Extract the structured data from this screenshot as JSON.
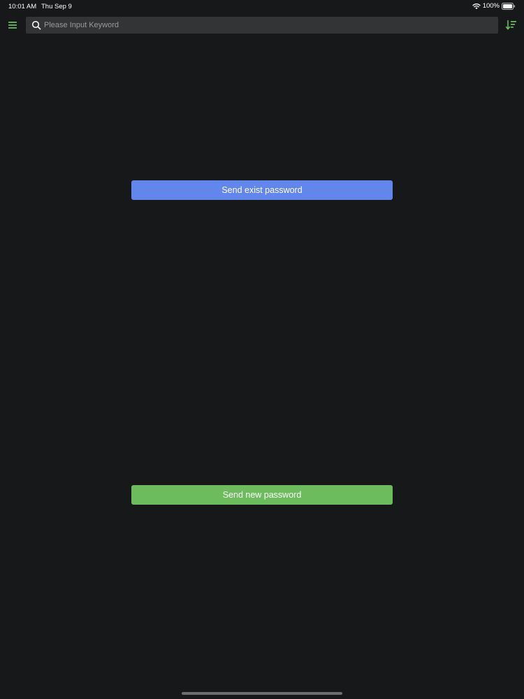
{
  "status_bar": {
    "time": "10:01 AM",
    "date": "Thu Sep 9",
    "battery": "100%"
  },
  "toolbar": {
    "menu_icon": "hamburger-menu-icon",
    "search": {
      "placeholder": "Please Input Keyword",
      "value": "",
      "icon": "search-icon"
    },
    "sort_icon": "sort-descending-icon"
  },
  "actions": {
    "send_exist_label": "Send exist password",
    "send_new_label": "Send new password"
  },
  "colors": {
    "background": "#17181a",
    "accent_green": "#6cbc5d",
    "accent_blue": "#6286ec",
    "search_bg": "#333436"
  }
}
